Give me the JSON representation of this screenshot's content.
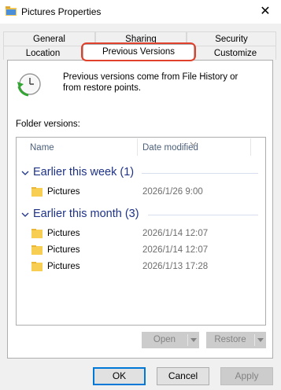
{
  "window": {
    "title": "Pictures Properties",
    "close_glyph": "✕"
  },
  "tabs": {
    "row1": [
      {
        "label": "General"
      },
      {
        "label": "Sharing"
      },
      {
        "label": "Security"
      }
    ],
    "row2": [
      {
        "label": "Location"
      },
      {
        "label": "Previous Versions",
        "selected": true
      },
      {
        "label": "Customize"
      }
    ]
  },
  "highlight_color": "#e0412c",
  "info": {
    "text": "Previous versions come from File History or from restore points.",
    "icon": "file-history-icon"
  },
  "folder_versions_label": "Folder versions:",
  "list": {
    "columns": [
      {
        "label": "Name"
      },
      {
        "label": "Date modified"
      }
    ],
    "groups": [
      {
        "title": "Earlier this week (1)",
        "items": [
          {
            "name": "Pictures",
            "date": "2026/1/26 9:00"
          }
        ]
      },
      {
        "title": "Earlier this month (3)",
        "items": [
          {
            "name": "Pictures",
            "date": "2026/1/14 12:07"
          },
          {
            "name": "Pictures",
            "date": "2026/1/14 12:07"
          },
          {
            "name": "Pictures",
            "date": "2026/1/13 17:28"
          }
        ]
      }
    ]
  },
  "actions": {
    "open": "Open",
    "restore": "Restore"
  },
  "buttons": {
    "ok": "OK",
    "cancel": "Cancel",
    "apply": "Apply"
  }
}
